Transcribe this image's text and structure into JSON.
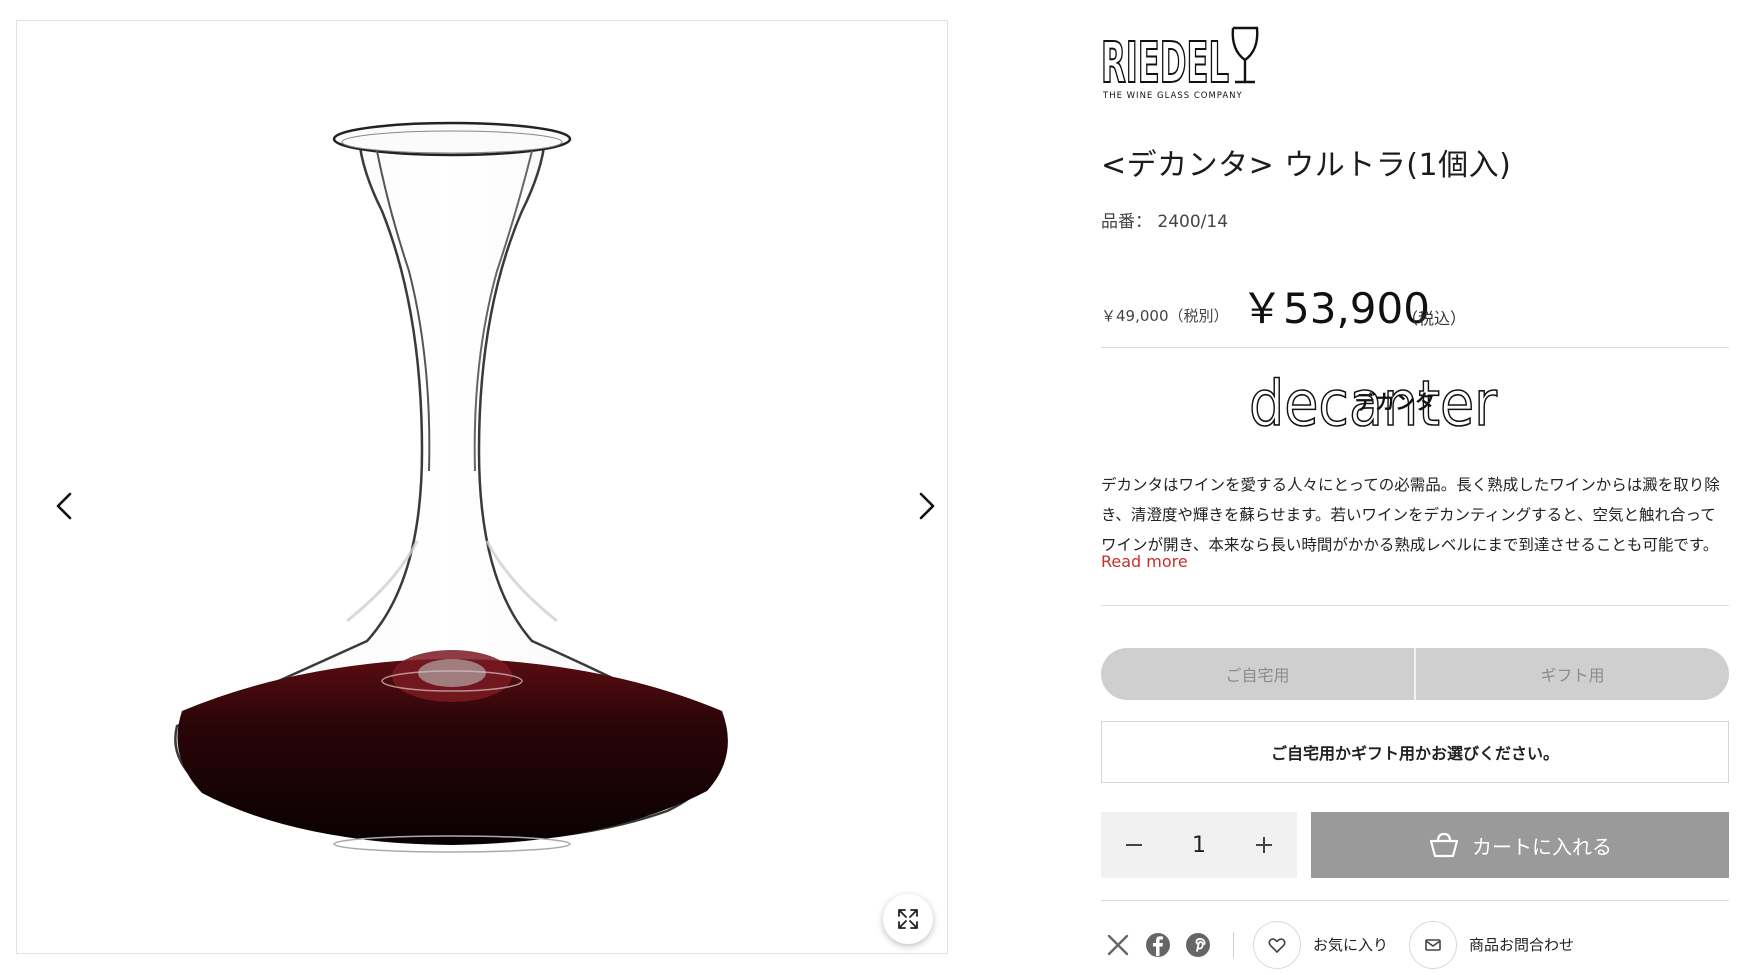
{
  "gallery": {
    "image_alt": "RIEDEL decanter Ultra"
  },
  "brand": {
    "name": "RIEDEL",
    "tagline": "THE WINE GLASS COMPANY"
  },
  "product": {
    "title": "<デカンタ> ウルトラ(1個入)",
    "sku_label": "品番：",
    "sku": "2400/14",
    "price_ex_tax": "￥49,000（税別）",
    "price_main": "￥53,900",
    "price_inc_label": "（税込）"
  },
  "category": {
    "script_name": "decanter",
    "jp_name": "デカンタ"
  },
  "description": {
    "text": "デカンタはワインを愛する人々にとっての必需品。長く熟成したワインからは澱を取り除き、清澄度や輝きを蘇らせます。若いワインをデカンティングすると、空気と触れ合ってワインが開き、本来なら長い時間がかかる熟成レベルにまで到達させることも可能です。",
    "read_more": "Read more"
  },
  "purpose_toggle": {
    "options": [
      "ご自宅用",
      "ギフト用"
    ]
  },
  "notice": "ご自宅用かギフト用かお選びください。",
  "quantity": {
    "value": "1"
  },
  "cart_button": "カートに入れる",
  "share": {
    "favorite_label": "お気に入り",
    "inquiry_label": "商品お問合わせ"
  }
}
